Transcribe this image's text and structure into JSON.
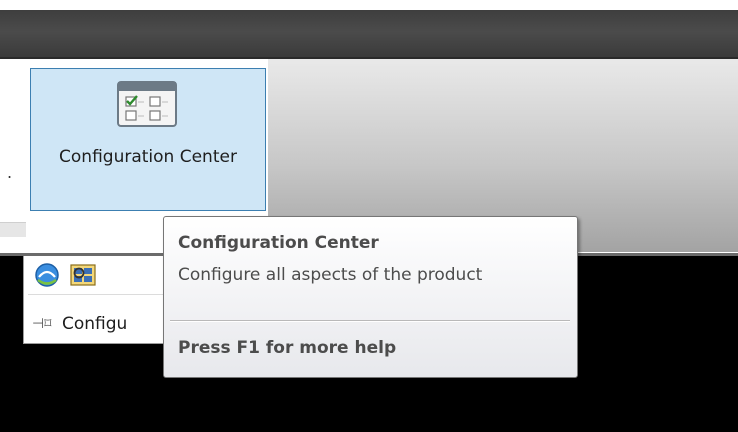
{
  "ribbon": {
    "left_marker": ".",
    "config_button_label": "Configuration Center"
  },
  "subpanel": {
    "label": "Configu",
    "icons": [
      "globe-refresh-icon",
      "search-panel-icon"
    ]
  },
  "tooltip": {
    "title": "Configuration Center",
    "description": "Configure all aspects of the product",
    "help": "Press F1 for more help"
  },
  "colors": {
    "button_highlight": "#cfe6f6",
    "button_border": "#3c7fb1",
    "title_bar": "#444444"
  }
}
